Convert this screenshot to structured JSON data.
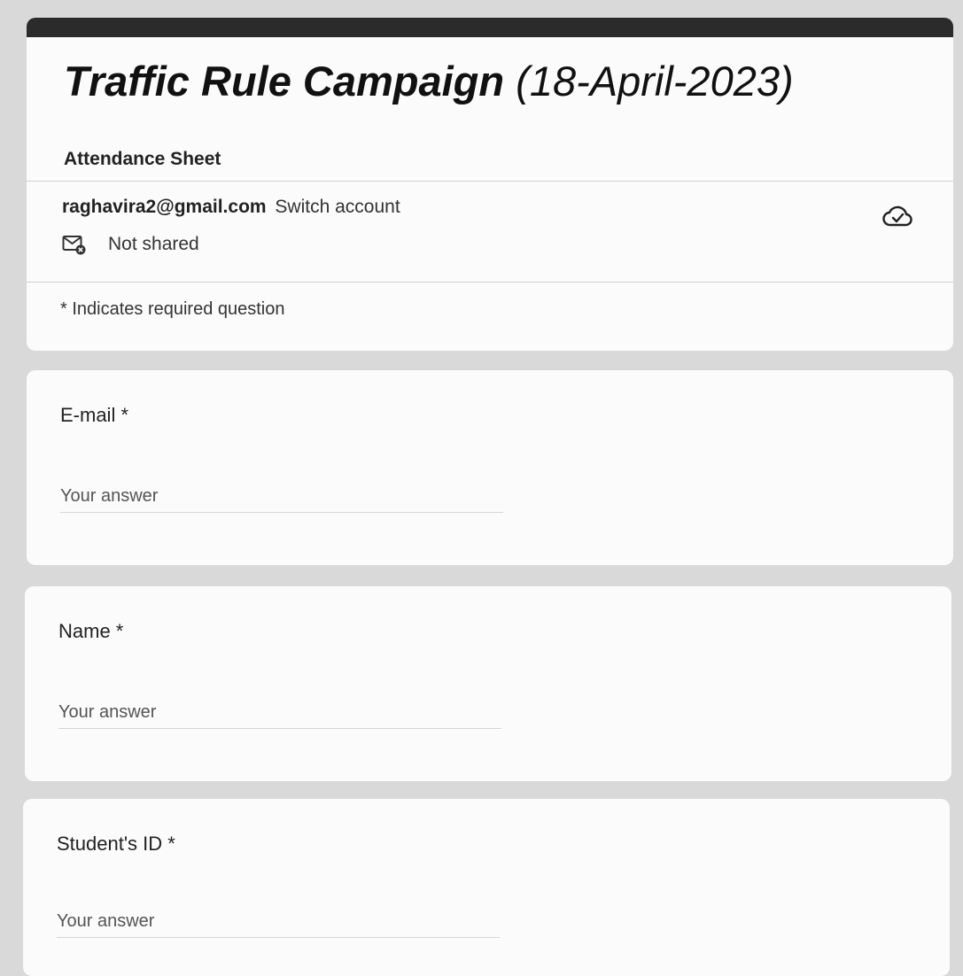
{
  "form": {
    "title_main": "Traffic Rule Campaign",
    "title_date": "(18-April-2023)",
    "description": "Attendance Sheet"
  },
  "account": {
    "email": "raghavira2@gmail.com",
    "switch_label": "Switch account",
    "shared_status": "Not shared",
    "icons": {
      "saved": "cloud-check-icon",
      "mail": "mail-not-shared-icon"
    }
  },
  "required_note": "* Indicates required question",
  "questions": [
    {
      "label": "E-mail *",
      "placeholder": "Your answer"
    },
    {
      "label": "Name  *",
      "placeholder": "Your answer"
    },
    {
      "label": "Student's ID *",
      "placeholder": "Your answer"
    }
  ],
  "colors": {
    "header_bar": "#2b2b2b",
    "background": "#d9d9d9",
    "card": "#fbfbfb"
  }
}
